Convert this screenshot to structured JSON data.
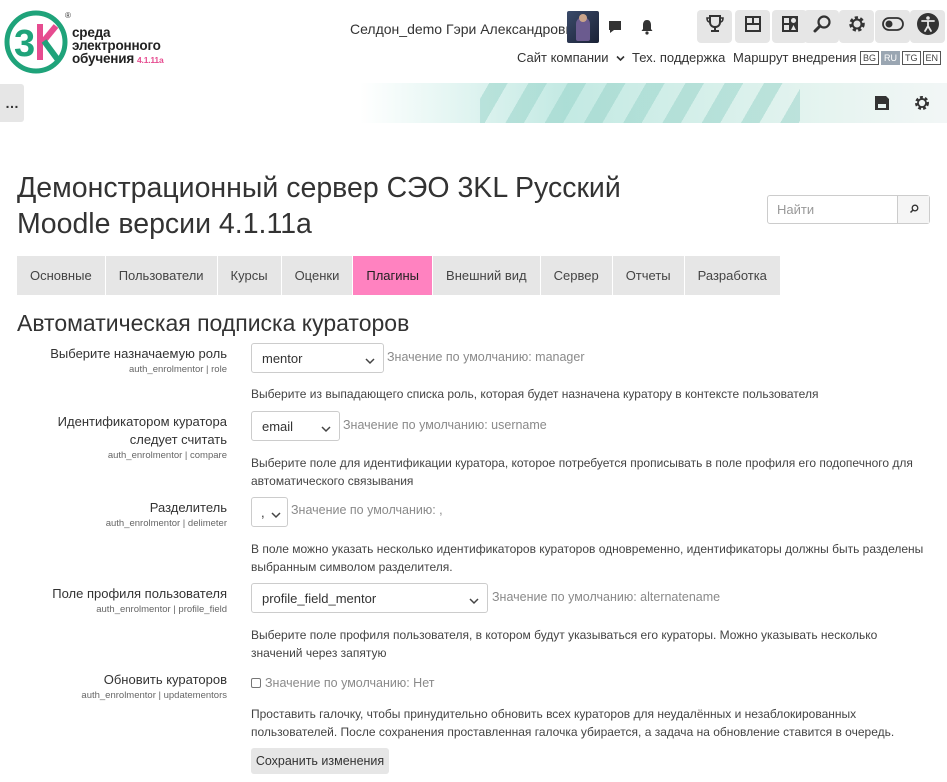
{
  "brand": {
    "line1": "среда",
    "line2": "электронного",
    "line3": "обучения",
    "version": "4.1.11a",
    "reg": "®",
    "color_green": "#1fa37a",
    "color_pink": "#e64c90"
  },
  "header": {
    "user_name": "Селдон_demo Гэри Александрович",
    "icons": [
      "message-icon",
      "bell-icon",
      "trophy-icon",
      "grid-icon",
      "apps-icon",
      "search-icon",
      "gear-icon",
      "toggle-icon",
      "accessibility-icon"
    ],
    "links": {
      "company_site": "Сайт компании",
      "support": "Тех. поддержка",
      "route": "Маршрут внедрения"
    },
    "languages": [
      "BG",
      "RU",
      "TG",
      "EN"
    ],
    "active_language": "RU"
  },
  "banner": {
    "drawer_label": "…"
  },
  "page": {
    "title": "Демонстрационный сервер СЭО 3KL Русский Moodle версии 4.1.11а",
    "search_placeholder": "Найти"
  },
  "tabs": [
    "Основные",
    "Пользователи",
    "Курсы",
    "Оценки",
    "Плагины",
    "Внешний вид",
    "Сервер",
    "Отчеты",
    "Разработка"
  ],
  "active_tab": "Плагины",
  "accent_color": "#ff82c0",
  "section": {
    "title": "Автоматическая подписка кураторов",
    "settings": [
      {
        "label": "Выберите назначаемую роль",
        "key": "auth_enrolmentor | role",
        "value": "mentor",
        "default": "Значение по умолчанию: manager",
        "description": "Выберите из выпадающего списка роль, которая будет назначена куратору в контексте пользователя"
      },
      {
        "label": "Идентификатором куратора следует считать",
        "key": "auth_enrolmentor | compare",
        "value": "email",
        "default": "Значение по умолчанию: username",
        "description": "Выберите поле для идентификации куратора, которое потребуется прописывать в поле профиля его подопечного для автоматического связывания"
      },
      {
        "label": "Разделитель",
        "key": "auth_enrolmentor | delimeter",
        "value": ",",
        "default": "Значение по умолчанию: ,",
        "description": "В поле можно указать несколько идентификаторов кураторов одновременно, идентификаторы должны быть разделены выбранным символом разделителя."
      },
      {
        "label": "Поле профиля пользователя",
        "key": "auth_enrolmentor | profile_field",
        "value": "profile_field_mentor",
        "default": "Значение по умолчанию: alternatename",
        "description": "Выберите поле профиля пользователя, в котором будут указываться его кураторы. Можно указывать несколько значений через запятую"
      },
      {
        "label": "Обновить кураторов",
        "key": "auth_enrolmentor | updatementors",
        "checked": false,
        "default": "Значение по умолчанию: Нет",
        "description": "Проставить галочку, чтобы принудительно обновить всех кураторов для неудалённых и незаблокированных пользователей. После сохранения проставленная галочка убирается, а задача на обновление ставится в очередь."
      }
    ],
    "save_label": "Сохранить изменения"
  }
}
